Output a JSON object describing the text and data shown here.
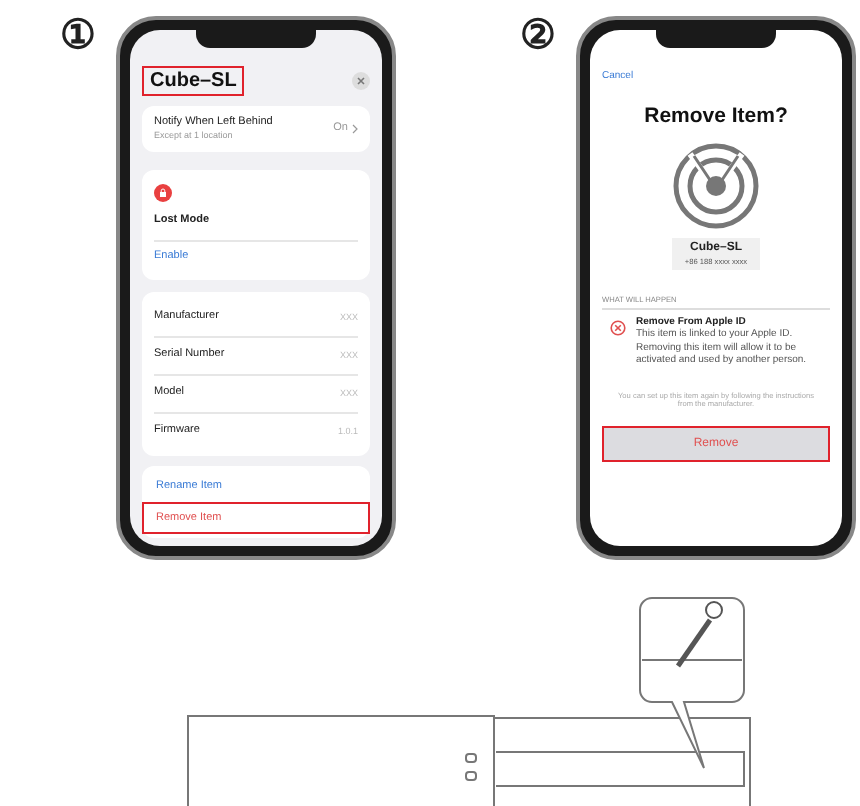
{
  "step_1": {
    "number": "①",
    "title": {
      "text": "Cube–SL",
      "highlighted": true
    },
    "notify": {
      "label": "Notify When Left Behind",
      "detail": "Except at 1 location",
      "value": "On"
    },
    "lost_mode": {
      "label": "Lost Mode",
      "action": "Enable"
    },
    "info_rows": [
      {
        "label": "Manufacturer",
        "value": "XXX"
      },
      {
        "label": "Serial Number",
        "value": "XXX"
      },
      {
        "label": "Model",
        "value": "XXX"
      },
      {
        "label": "Firmware",
        "value": "1.0.1"
      }
    ],
    "actions": [
      {
        "label": "Rename Item",
        "kind": "normal",
        "highlighted": false
      },
      {
        "label": "Remove Item",
        "kind": "destructive",
        "highlighted": true
      }
    ]
  },
  "step_2": {
    "number": "②",
    "cancel": "Cancel",
    "title": "Remove Item?",
    "item": {
      "name": "Cube–SL",
      "phone": "+86 188 xxxx xxxx"
    },
    "section_header": "WHAT WILL HAPPEN",
    "consequence": {
      "title": "Remove From Apple ID",
      "text": "This item is linked to your Apple ID. Removing this item will allow it to be activated and used by another person."
    },
    "footnote": "You can set up this item again by following the instructions from the manufacturer.",
    "button": {
      "label": "Remove",
      "highlighted": true
    }
  }
}
